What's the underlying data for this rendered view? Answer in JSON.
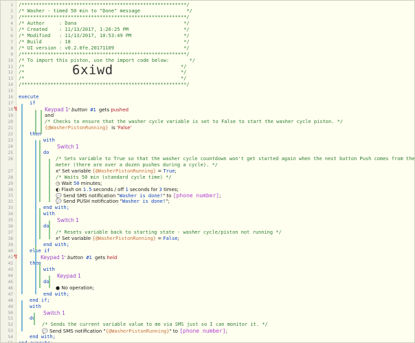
{
  "lines": [
    {
      "n": "1",
      "segs": [
        {
          "t": "/*********************************************************/",
          "k": "c"
        }
      ]
    },
    {
      "n": "2",
      "segs": [
        {
          "t": "/* Washer - timed 50 min to \"Done\" message                */",
          "k": "c"
        }
      ]
    },
    {
      "n": "3",
      "segs": [
        {
          "t": "/*********************************************************/",
          "k": "c"
        }
      ]
    },
    {
      "n": "4",
      "segs": [
        {
          "t": "/* Author     : Dana                                     */",
          "k": "c"
        }
      ]
    },
    {
      "n": "5",
      "segs": [
        {
          "t": "/* Created    : 11/13/2017, 1:26:25 PM                   */",
          "k": "c"
        }
      ]
    },
    {
      "n": "6",
      "segs": [
        {
          "t": "/* Modified   : 11/13/2017, 10:53:49 PM                  */",
          "k": "c"
        }
      ]
    },
    {
      "n": "7",
      "segs": [
        {
          "t": "/* Build      : 18                                       */",
          "k": "c"
        }
      ]
    },
    {
      "n": "8",
      "segs": [
        {
          "t": "/* UI version : v0.2.0fe.20171109                        */",
          "k": "c"
        }
      ]
    },
    {
      "n": "9",
      "segs": [
        {
          "t": "/*********************************************************/",
          "k": "c"
        }
      ]
    },
    {
      "n": "10",
      "segs": [
        {
          "t": "/* To import this piston, use the import code below:       */",
          "k": "c"
        }
      ]
    },
    {
      "n": "11",
      "segs": [
        {
          "t": "/*                                                      */",
          "k": "c"
        }
      ]
    },
    {
      "n": "12",
      "segs": [
        {
          "t": "/*                                                      */",
          "k": "c"
        }
      ]
    },
    {
      "n": "13",
      "segs": [
        {
          "t": "/*                                                      */",
          "k": "c"
        }
      ]
    },
    {
      "n": "14",
      "segs": [
        {
          "t": "/*********************************************************/",
          "k": "c"
        }
      ]
    },
    {
      "n": "15",
      "segs": []
    },
    {
      "n": "16",
      "segs": [
        {
          "t": "execute",
          "k": "kw"
        }
      ]
    },
    {
      "n": "17",
      "indent": 16,
      "segs": [
        {
          "t": "if",
          "k": "kw"
        }
      ]
    },
    {
      "n": "18",
      "indent": 38,
      "marker": true,
      "segs": [
        {
          "t": "Keypad 1",
          "k": "dev"
        },
        {
          "t": "' ",
          "k": "pl"
        },
        {
          "t": "button",
          "k": "it"
        },
        {
          "t": " #1 ",
          "k": "num"
        },
        {
          "t": "gets ",
          "k": "pl"
        },
        {
          "t": "pushed",
          "k": "red"
        }
      ]
    },
    {
      "n": "19",
      "indent": 38,
      "segs": [
        {
          "t": "and",
          "k": "pl"
        }
      ]
    },
    {
      "n": "20",
      "indent": 38,
      "segs": [
        {
          "t": "/* Checks to ensure that the washer cycle variable is set to False to start the washer cycle piston. */",
          "k": "c"
        }
      ]
    },
    {
      "n": "21",
      "indent": 38,
      "segs": [
        {
          "t": "{@WasherPistonRunning}",
          "k": "var"
        },
        {
          "t": "  is ",
          "k": "pl"
        },
        {
          "t": "'False'",
          "k": "red"
        }
      ]
    },
    {
      "n": "22",
      "indent": 16,
      "segs": [
        {
          "t": "then",
          "k": "kw"
        }
      ]
    },
    {
      "n": "23",
      "indent": 36,
      "segs": [
        {
          "t": "with",
          "k": "kw"
        }
      ]
    },
    {
      "n": "24",
      "indent": 56,
      "segs": [
        {
          "t": "Switch 1",
          "k": "dev"
        }
      ]
    },
    {
      "n": "25",
      "indent": 36,
      "segs": [
        {
          "t": "do",
          "k": "kw"
        }
      ]
    },
    {
      "n": "26",
      "indent": 54,
      "segs": [
        {
          "t": "/* Sets variable to True so that the washer cycle countdown won't get started again when the next button Push comes from the energy",
          "k": "c"
        }
      ]
    },
    {
      "n": "",
      "indent": 54,
      "segs": [
        {
          "t": "meter (there are over a dozen pushes during a cycle). */",
          "k": "c"
        }
      ]
    },
    {
      "n": "27",
      "indent": 54,
      "segs": [
        {
          "t": "x²",
          "k": "pl"
        },
        {
          "t": " Set variable ",
          "k": "pl"
        },
        {
          "t": "{@WasherPistonRunning}",
          "k": "var"
        },
        {
          "t": " = ",
          "k": "pl"
        },
        {
          "t": "True",
          "k": "str"
        },
        {
          "t": ";",
          "k": "pl"
        }
      ]
    },
    {
      "n": "28",
      "indent": 54,
      "segs": [
        {
          "t": "/* Waits 50 min (standard cycle time) */",
          "k": "c"
        }
      ]
    },
    {
      "n": "29",
      "indent": 54,
      "segs": [
        {
          "t": "◷",
          "k": "pl"
        },
        {
          "t": " Wait ",
          "k": "pl"
        },
        {
          "t": "50",
          "k": "num"
        },
        {
          "t": " minutes",
          "k": "pl"
        },
        {
          "t": ";",
          "k": "pl"
        }
      ]
    },
    {
      "n": "30",
      "indent": 54,
      "segs": [
        {
          "t": "◐",
          "k": "pl"
        },
        {
          "t": " Flash on ",
          "k": "pl"
        },
        {
          "t": "1.5",
          "k": "num"
        },
        {
          "t": " seconds / off ",
          "k": "pl"
        },
        {
          "t": "1",
          "k": "num"
        },
        {
          "t": " seconds for ",
          "k": "pl"
        },
        {
          "t": "3",
          "k": "num"
        },
        {
          "t": " times;",
          "k": "pl"
        }
      ]
    },
    {
      "n": "31",
      "indent": 54,
      "segs": [
        {
          "t": "💬",
          "k": "pl"
        },
        {
          "t": " Send SMS notification \"",
          "k": "pl"
        },
        {
          "t": "Washer is done!",
          "k": "str"
        },
        {
          "t": "\" to ",
          "k": "pl"
        },
        {
          "t": "[phone number]",
          "k": "arg"
        },
        {
          "t": ";",
          "k": "pl"
        }
      ]
    },
    {
      "n": "32",
      "indent": 54,
      "segs": [
        {
          "t": "💬",
          "k": "pl"
        },
        {
          "t": " Send PUSH notification \"",
          "k": "pl"
        },
        {
          "t": "Washer is done!",
          "k": "str"
        },
        {
          "t": "\";",
          "k": "pl"
        }
      ]
    },
    {
      "n": "33",
      "indent": 36,
      "segs": [
        {
          "t": "end with;",
          "k": "kw"
        }
      ]
    },
    {
      "n": "34",
      "indent": 36,
      "segs": [
        {
          "t": "with",
          "k": "kw"
        }
      ]
    },
    {
      "n": "35",
      "indent": 56,
      "segs": [
        {
          "t": "Switch 1",
          "k": "dev"
        }
      ]
    },
    {
      "n": "36",
      "indent": 36,
      "segs": [
        {
          "t": "do",
          "k": "kw"
        }
      ]
    },
    {
      "n": "37",
      "indent": 54,
      "segs": [
        {
          "t": "/* Resets variable back to starting state - washer cycle/piston not running */",
          "k": "c"
        }
      ]
    },
    {
      "n": "38",
      "indent": 54,
      "segs": [
        {
          "t": "x²",
          "k": "pl"
        },
        {
          "t": " Set variable ",
          "k": "pl"
        },
        {
          "t": "{@WasherPistonRunning}",
          "k": "var"
        },
        {
          "t": " = ",
          "k": "pl"
        },
        {
          "t": "False",
          "k": "str"
        },
        {
          "t": ";",
          "k": "pl"
        }
      ]
    },
    {
      "n": "39",
      "indent": 36,
      "segs": [
        {
          "t": "end with;",
          "k": "kw"
        }
      ]
    },
    {
      "n": "40",
      "indent": 16,
      "segs": [
        {
          "t": "else if",
          "k": "kw"
        }
      ]
    },
    {
      "n": "41",
      "indent": 32,
      "marker": true,
      "segs": [
        {
          "t": "Keypad 1",
          "k": "dev"
        },
        {
          "t": "' ",
          "k": "pl"
        },
        {
          "t": "button",
          "k": "it"
        },
        {
          "t": " #1 ",
          "k": "num"
        },
        {
          "t": "gets ",
          "k": "pl"
        },
        {
          "t": "held",
          "k": "red"
        }
      ]
    },
    {
      "n": "42",
      "indent": 16,
      "segs": [
        {
          "t": "then",
          "k": "kw"
        }
      ]
    },
    {
      "n": "43",
      "indent": 36,
      "segs": [
        {
          "t": "with",
          "k": "kw"
        }
      ]
    },
    {
      "n": "44",
      "indent": 56,
      "segs": [
        {
          "t": "Keypad 1",
          "k": "dev"
        }
      ]
    },
    {
      "n": "45",
      "indent": 36,
      "segs": [
        {
          "t": "do",
          "k": "kw"
        }
      ]
    },
    {
      "n": "46",
      "indent": 54,
      "segs": [
        {
          "t": "●",
          "k": "pl"
        },
        {
          "t": " No operation",
          "k": "pl"
        },
        {
          "t": ";",
          "k": "pl"
        }
      ]
    },
    {
      "n": "47",
      "indent": 36,
      "segs": [
        {
          "t": "end with;",
          "k": "kw"
        }
      ]
    },
    {
      "n": "48",
      "indent": 16,
      "segs": [
        {
          "t": "end if;",
          "k": "kw"
        }
      ]
    },
    {
      "n": "49",
      "indent": 16,
      "segs": [
        {
          "t": "with",
          "k": "kw"
        }
      ]
    },
    {
      "n": "50",
      "indent": 36,
      "segs": [
        {
          "t": "Switch 1",
          "k": "dev"
        }
      ]
    },
    {
      "n": "51",
      "indent": 16,
      "segs": [
        {
          "t": "do",
          "k": "kw"
        }
      ]
    },
    {
      "n": "52",
      "indent": 34,
      "segs": [
        {
          "t": "/* Sends the current variable value to me via SMS just so I can monitor it. */",
          "k": "c"
        }
      ]
    },
    {
      "n": "53",
      "indent": 34,
      "segs": [
        {
          "t": "💬",
          "k": "pl"
        },
        {
          "t": " Send SMS notification \"",
          "k": "pl"
        },
        {
          "t": "{@WasherPistonRunning}",
          "k": "var"
        },
        {
          "t": "\" to ",
          "k": "pl"
        },
        {
          "t": "[phone number]",
          "k": "arg"
        },
        {
          "t": ";",
          "k": "pl"
        }
      ]
    },
    {
      "n": "54",
      "indent": 16,
      "segs": [
        {
          "t": "end with;",
          "k": "kw"
        }
      ]
    },
    {
      "n": "55",
      "segs": [
        {
          "t": "end execute;",
          "k": "kw"
        }
      ]
    }
  ],
  "import_code": "6xiwd"
}
